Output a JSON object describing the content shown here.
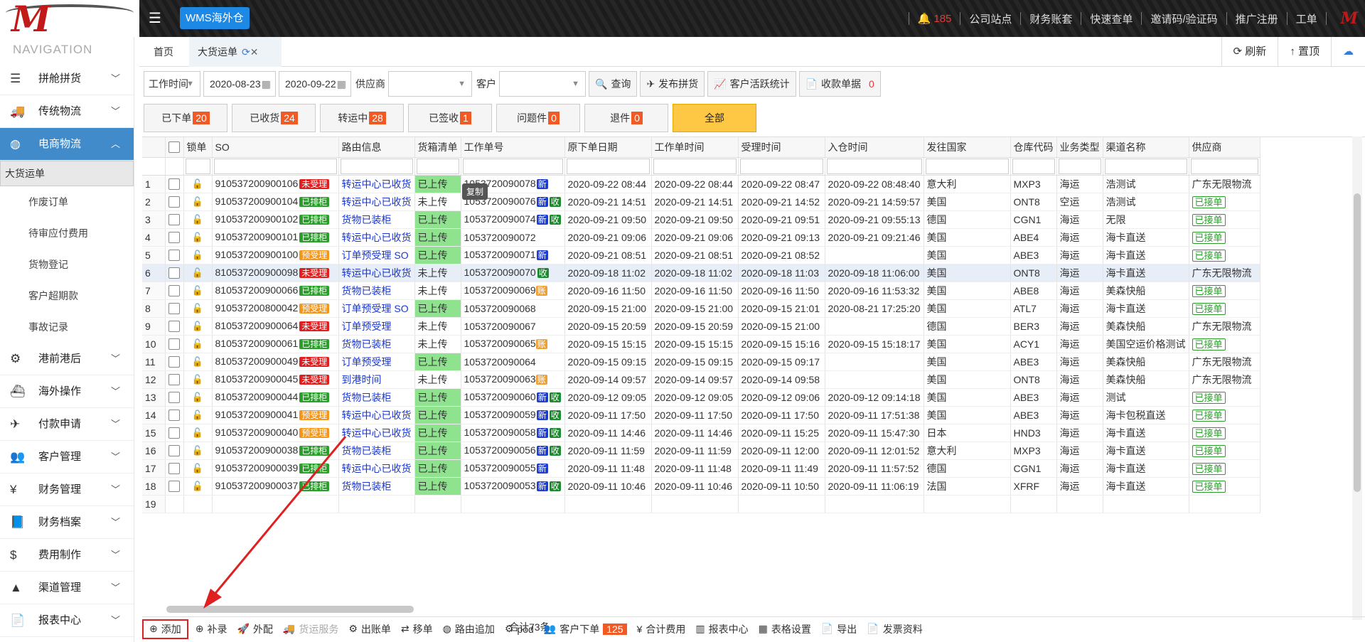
{
  "topbar": {
    "wms": "WMS海外仓",
    "bell_count": "185",
    "links": [
      "公司站点",
      "财务账套",
      "快速查单",
      "邀请码/验证码",
      "推广注册",
      "工单"
    ]
  },
  "sidebar": {
    "title": "NAVIGATION",
    "items": [
      {
        "label": "拼舱拼货",
        "icon": "☰"
      },
      {
        "label": "传统物流",
        "icon": "🚚"
      },
      {
        "label": "电商物流",
        "icon": "◍",
        "active": true
      },
      {
        "label": "港前港后",
        "icon": "⚙"
      },
      {
        "label": "海外操作",
        "icon": "⛴"
      },
      {
        "label": "付款申请",
        "icon": "✈"
      },
      {
        "label": "客户管理",
        "icon": "👥"
      },
      {
        "label": "财务管理",
        "icon": "¥"
      },
      {
        "label": "财务档案",
        "icon": "📘"
      },
      {
        "label": "费用制作",
        "icon": "$"
      },
      {
        "label": "渠道管理",
        "icon": "▲"
      },
      {
        "label": "报表中心",
        "icon": "📄"
      }
    ],
    "sub": [
      "大货运单",
      "作废订单",
      "待审应付费用",
      "货物登记",
      "客户超期款",
      "事故记录"
    ]
  },
  "tabs": {
    "home": "首页",
    "active": "大货运单",
    "refresh": "刷新",
    "top": "置顶"
  },
  "filters": {
    "time_field": "工作时间",
    "date_from": "2020-08-23",
    "date_to": "2020-09-22",
    "supplier_label": "供应商",
    "customer_label": "客户",
    "query": "查询",
    "publish": "发布拼货",
    "stats": "客户活跃统计",
    "receipt": "收款单据",
    "receipt_count": "0"
  },
  "status": [
    {
      "label": "已下单",
      "count": "20"
    },
    {
      "label": "已收货",
      "count": "24"
    },
    {
      "label": "转运中",
      "count": "28"
    },
    {
      "label": "已签收",
      "count": "1"
    },
    {
      "label": "问题件",
      "count": "0"
    },
    {
      "label": "退件",
      "count": "0"
    },
    {
      "label": "全部",
      "count": ""
    }
  ],
  "columns": [
    "锁单",
    "SO",
    "路由信息",
    "货箱清单",
    "工作单号",
    "原下单日期",
    "工作单时间",
    "受理时间",
    "入仓时间",
    "发往国家",
    "仓库代码",
    "业务类型",
    "渠道名称",
    "供应商"
  ],
  "rows": [
    {
      "n": "1",
      "so": "910537200900106",
      "st": "未受理",
      "sc": "red",
      "route": "转运中心已收货",
      "box": "已上传",
      "wo": "1053720090078",
      "tags": [
        "新"
      ],
      "d1": "2020-09-22 08:44",
      "d2": "2020-09-22 08:44",
      "d3": "2020-09-22 08:47",
      "d4": "2020-09-22 08:48:40",
      "country": "意大利",
      "wh": "MXP3",
      "biz": "海运",
      "ch": "浩测试",
      "sup": "广东无限物流"
    },
    {
      "n": "2",
      "so": "910537200900104",
      "st": "已排柜",
      "sc": "green",
      "route": "转运中心已收货",
      "box": "未上传",
      "wo": "1053720090076",
      "tags": [
        "新",
        "收"
      ],
      "d1": "2020-09-21 14:51",
      "d2": "2020-09-21 14:51",
      "d3": "2020-09-21 14:52",
      "d4": "2020-09-21 14:59:57",
      "country": "美国",
      "wh": "ONT8",
      "biz": "空运",
      "ch": "浩测试",
      "sup": "已接单"
    },
    {
      "n": "3",
      "so": "910537200900102",
      "st": "已排柜",
      "sc": "green",
      "route": "货物已装柜",
      "box": "已上传",
      "wo": "1053720090074",
      "tags": [
        "新",
        "收"
      ],
      "d1": "2020-09-21 09:50",
      "d2": "2020-09-21 09:50",
      "d3": "2020-09-21 09:51",
      "d4": "2020-09-21 09:55:13",
      "country": "德国",
      "wh": "CGN1",
      "biz": "海运",
      "ch": "无限",
      "sup": "已接单"
    },
    {
      "n": "4",
      "so": "910537200900101",
      "st": "已排柜",
      "sc": "green",
      "route": "转运中心已收货",
      "box": "已上传",
      "wo": "1053720090072",
      "tags": [],
      "d1": "2020-09-21 09:06",
      "d2": "2020-09-21 09:06",
      "d3": "2020-09-21 09:13",
      "d4": "2020-09-21 09:21:46",
      "country": "美国",
      "wh": "ABE4",
      "biz": "海运",
      "ch": "海卡直送",
      "sup": "已接单"
    },
    {
      "n": "5",
      "so": "910537200900100",
      "st": "预受理",
      "sc": "orange",
      "route": "订单预受理 SO",
      "box": "已上传",
      "wo": "1053720090071",
      "tags": [
        "新"
      ],
      "d1": "2020-09-21 08:51",
      "d2": "2020-09-21 08:51",
      "d3": "2020-09-21 08:52",
      "d4": "",
      "country": "美国",
      "wh": "ABE3",
      "biz": "海运",
      "ch": "海卡直送",
      "sup": "已接单"
    },
    {
      "n": "6",
      "so": "810537200900098",
      "st": "未受理",
      "sc": "red",
      "route": "转运中心已收货",
      "box": "未上传",
      "wo": "1053720090070",
      "tags": [
        "收"
      ],
      "d1": "2020-09-18 11:02",
      "d2": "2020-09-18 11:02",
      "d3": "2020-09-18 11:03",
      "d4": "2020-09-18 11:06:00",
      "country": "美国",
      "wh": "ONT8",
      "biz": "海运",
      "ch": "海卡直送",
      "sup": "广东无限物流"
    },
    {
      "n": "7",
      "so": "810537200900066",
      "st": "已排柜",
      "sc": "green",
      "route": "货物已装柜",
      "box": "未上传",
      "wo": "1053720090069",
      "tags": [
        "账"
      ],
      "d1": "2020-09-16 11:50",
      "d2": "2020-09-16 11:50",
      "d3": "2020-09-16 11:50",
      "d4": "2020-09-16 11:53:32",
      "country": "美国",
      "wh": "ABE8",
      "biz": "海运",
      "ch": "美森快船",
      "sup": "已接单"
    },
    {
      "n": "8",
      "so": "910537200800042",
      "st": "预受理",
      "sc": "orange",
      "route": "订单预受理 SO",
      "box": "已上传",
      "wo": "1053720090068",
      "tags": [],
      "d1": "2020-09-15 21:00",
      "d2": "2020-09-15 21:00",
      "d3": "2020-09-15 21:01",
      "d4": "2020-08-21 17:25:20",
      "country": "美国",
      "wh": "ATL7",
      "biz": "海运",
      "ch": "海卡直送",
      "sup": "已接单"
    },
    {
      "n": "9",
      "so": "810537200900064",
      "st": "未受理",
      "sc": "red",
      "route": "订单预受理",
      "box": "未上传",
      "wo": "1053720090067",
      "tags": [],
      "d1": "2020-09-15 20:59",
      "d2": "2020-09-15 20:59",
      "d3": "2020-09-15 21:00",
      "d4": "",
      "country": "德国",
      "wh": "BER3",
      "biz": "海运",
      "ch": "美森快船",
      "sup": "广东无限物流"
    },
    {
      "n": "10",
      "so": "810537200900061",
      "st": "已排柜",
      "sc": "green",
      "route": "货物已装柜",
      "box": "未上传",
      "wo": "1053720090065",
      "tags": [
        "账"
      ],
      "d1": "2020-09-15 15:15",
      "d2": "2020-09-15 15:15",
      "d3": "2020-09-15 15:16",
      "d4": "2020-09-15 15:18:17",
      "country": "美国",
      "wh": "ACY1",
      "biz": "海运",
      "ch": "美国空运价格测试",
      "sup": "已接单"
    },
    {
      "n": "11",
      "so": "810537200900049",
      "st": "未受理",
      "sc": "red",
      "route": "订单预受理",
      "box": "已上传",
      "wo": "1053720090064",
      "tags": [],
      "d1": "2020-09-15 09:15",
      "d2": "2020-09-15 09:15",
      "d3": "2020-09-15 09:17",
      "d4": "",
      "country": "美国",
      "wh": "ABE3",
      "biz": "海运",
      "ch": "美森快船",
      "sup": "广东无限物流"
    },
    {
      "n": "12",
      "so": "810537200900045",
      "st": "未受理",
      "sc": "red",
      "route": "到港时间",
      "box": "未上传",
      "wo": "1053720090063",
      "tags": [
        "账"
      ],
      "d1": "2020-09-14 09:57",
      "d2": "2020-09-14 09:57",
      "d3": "2020-09-14 09:58",
      "d4": "",
      "country": "美国",
      "wh": "ONT8",
      "biz": "海运",
      "ch": "美森快船",
      "sup": "广东无限物流"
    },
    {
      "n": "13",
      "so": "810537200900044",
      "st": "已排柜",
      "sc": "green",
      "route": "货物已装柜",
      "box": "已上传",
      "wo": "1053720090060",
      "tags": [
        "新",
        "收"
      ],
      "d1": "2020-09-12 09:05",
      "d2": "2020-09-12 09:05",
      "d3": "2020-09-12 09:06",
      "d4": "2020-09-12 09:14:18",
      "country": "美国",
      "wh": "ABE3",
      "biz": "海运",
      "ch": "测试",
      "sup": "已接单"
    },
    {
      "n": "14",
      "so": "910537200900041",
      "st": "预受理",
      "sc": "orange",
      "route": "转运中心已收货",
      "box": "已上传",
      "wo": "1053720090059",
      "tags": [
        "新",
        "收"
      ],
      "d1": "2020-09-11 17:50",
      "d2": "2020-09-11 17:50",
      "d3": "2020-09-11 17:50",
      "d4": "2020-09-11 17:51:38",
      "country": "美国",
      "wh": "ABE3",
      "biz": "海运",
      "ch": "海卡包税直送",
      "sup": "已接单"
    },
    {
      "n": "15",
      "so": "910537200900040",
      "st": "预受理",
      "sc": "orange",
      "route": "转运中心已收货",
      "box": "已上传",
      "wo": "1053720090058",
      "tags": [
        "新",
        "收"
      ],
      "d1": "2020-09-11 14:46",
      "d2": "2020-09-11 14:46",
      "d3": "2020-09-11 15:25",
      "d4": "2020-09-11 15:47:30",
      "country": "日本",
      "wh": "HND3",
      "biz": "海运",
      "ch": "海卡直送",
      "sup": "已接单"
    },
    {
      "n": "16",
      "so": "910537200900038",
      "st": "已排柜",
      "sc": "green",
      "route": "货物已装柜",
      "box": "已上传",
      "wo": "1053720090056",
      "tags": [
        "新",
        "收"
      ],
      "d1": "2020-09-11 11:59",
      "d2": "2020-09-11 11:59",
      "d3": "2020-09-11 12:00",
      "d4": "2020-09-11 12:01:52",
      "country": "意大利",
      "wh": "MXP3",
      "biz": "海运",
      "ch": "海卡直送",
      "sup": "已接单"
    },
    {
      "n": "17",
      "so": "910537200900039",
      "st": "已排柜",
      "sc": "green",
      "route": "转运中心已收货",
      "box": "已上传",
      "wo": "1053720090055",
      "tags": [
        "新"
      ],
      "d1": "2020-09-11 11:48",
      "d2": "2020-09-11 11:48",
      "d3": "2020-09-11 11:49",
      "d4": "2020-09-11 11:57:52",
      "country": "德国",
      "wh": "CGN1",
      "biz": "海运",
      "ch": "海卡直送",
      "sup": "已接单"
    },
    {
      "n": "18",
      "so": "910537200900037",
      "st": "已排柜",
      "sc": "green",
      "route": "货物已装柜",
      "box": "已上传",
      "wo": "1053720090053",
      "tags": [
        "新",
        "收"
      ],
      "d1": "2020-09-11 10:46",
      "d2": "2020-09-11 10:46",
      "d3": "2020-09-11 10:50",
      "d4": "2020-09-11 11:06:19",
      "country": "法国",
      "wh": "XFRF",
      "biz": "海运",
      "ch": "海卡直送",
      "sup": "已接单"
    },
    {
      "n": "19",
      "so": "",
      "st": "",
      "sc": "",
      "route": "",
      "box": "",
      "wo": "",
      "tags": [],
      "d1": "",
      "d2": "",
      "d3": "",
      "d4": "",
      "country": "",
      "wh": "",
      "biz": "",
      "ch": "",
      "sup": ""
    }
  ],
  "tooltip": "复制",
  "summary": "合计73条",
  "bottom": [
    {
      "label": "添加",
      "icon": "⊕",
      "name": "add-button"
    },
    {
      "label": "补录",
      "icon": "⊕",
      "name": "supplement-button"
    },
    {
      "label": "外配",
      "icon": "🚀",
      "name": "external-button"
    },
    {
      "label": "货运服务",
      "icon": "🚚",
      "name": "freight-service-button",
      "dis": true
    },
    {
      "label": "出账单",
      "icon": "⚙",
      "name": "billing-button"
    },
    {
      "label": "移单",
      "icon": "⇄",
      "name": "move-order-button"
    },
    {
      "label": "路由追加",
      "icon": "◍",
      "name": "route-append-button"
    },
    {
      "label": "pod",
      "icon": "⚙",
      "name": "pod-button"
    },
    {
      "label": "客户下单",
      "icon": "👥",
      "name": "customer-order-button",
      "badge": "125"
    },
    {
      "label": "合计费用",
      "icon": "¥",
      "name": "total-fee-button"
    },
    {
      "label": "报表中心",
      "icon": "▥",
      "name": "report-button"
    },
    {
      "label": "表格设置",
      "icon": "▦",
      "name": "table-settings-button"
    },
    {
      "label": "导出",
      "icon": "📄",
      "name": "export-button"
    },
    {
      "label": "发票资料",
      "icon": "📄",
      "name": "invoice-button"
    }
  ]
}
